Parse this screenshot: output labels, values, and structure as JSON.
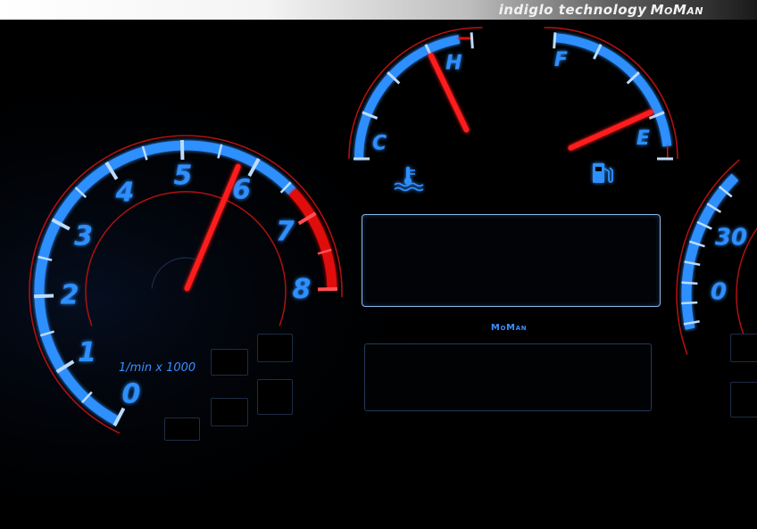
{
  "banner": {
    "text": "indiglo technology",
    "brand": "MoMan"
  },
  "center_brand": "MoMan",
  "tachometer": {
    "labels": [
      "0",
      "1",
      "2",
      "3",
      "4",
      "5",
      "6",
      "7",
      "8"
    ],
    "unit": "1/min x 1000",
    "needle_value": 5.8
  },
  "temperature": {
    "low_label": "C",
    "high_label": "H",
    "needle_fraction": 0.75
  },
  "fuel": {
    "full_label": "F",
    "empty_label": "E",
    "needle_fraction": 0.28
  },
  "speedometer": {
    "labels": [
      "0",
      "30"
    ]
  },
  "colors": {
    "glow_blue": "#2f8fff",
    "needle_red": "#ff1a1a",
    "warning_red": "#e01010",
    "background": "#000000"
  },
  "icons": [
    "coolant-temperature-icon",
    "fuel-pump-icon"
  ]
}
